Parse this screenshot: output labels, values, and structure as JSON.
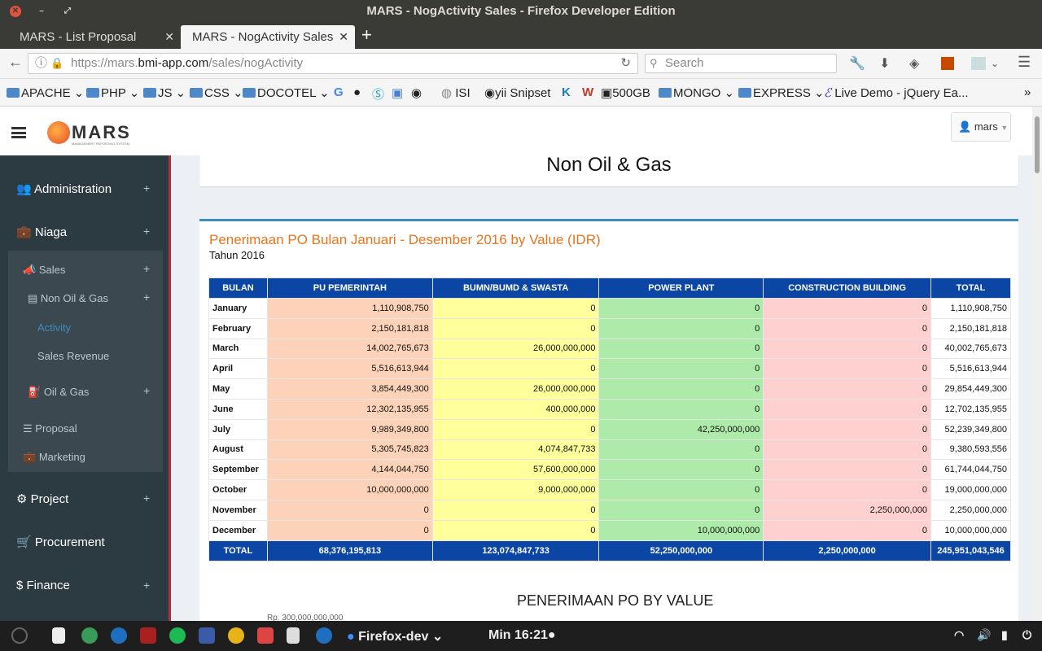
{
  "window": {
    "title": "MARS - NogActivity Sales - Firefox Developer Edition"
  },
  "tabs": [
    {
      "label": "MARS - List Proposal"
    },
    {
      "label": "MARS - NogActivity Sales"
    }
  ],
  "nav": {
    "url_prefix": "https://mars.",
    "url_domain": "bmi-app.com",
    "url_path": "/sales/nogActivity",
    "search_placeholder": "Search"
  },
  "bookmarks": [
    "APACHE",
    "PHP",
    "JS",
    "CSS",
    "DOCOTEL",
    "ISI",
    "yii Snipset",
    "500GB",
    "MONGO",
    "EXPRESS",
    "Live Demo - jQuery Ea..."
  ],
  "app": {
    "logo": "MARS",
    "logo_sub": "MANAGEMENT REPORTING SYSTEM",
    "user": "mars"
  },
  "sidebar": {
    "administration": "Administration",
    "niaga": "Niaga",
    "sales": "Sales",
    "non_oil_gas": "Non Oil & Gas",
    "activity": "Activity",
    "sales_revenue": "Sales Revenue",
    "oil_gas": "Oil & Gas",
    "proposal": "Proposal",
    "marketing": "Marketing",
    "project": "Project",
    "procurement": "Procurement",
    "finance": "Finance",
    "plus": "+"
  },
  "content": {
    "page_heading": "Non Oil & Gas",
    "box_title": "Penerimaan PO Bulan Januari - Desember 2016 by Value (IDR)",
    "box_subtitle": "Tahun 2016",
    "chart_title": "PENERIMAAN PO BY VALUE",
    "chart_axis_top": "Rp. 300,000,000,000"
  },
  "table": {
    "headers": [
      "BULAN",
      "PU PEMERINTAH",
      "BUMN/BUMD & SWASTA",
      "POWER PLANT",
      "CONSTRUCTION BUILDING",
      "TOTAL"
    ],
    "rows": [
      [
        "January",
        "1,110,908,750",
        "0",
        "0",
        "0",
        "1,110,908,750"
      ],
      [
        "February",
        "2,150,181,818",
        "0",
        "0",
        "0",
        "2,150,181,818"
      ],
      [
        "March",
        "14,002,765,673",
        "26,000,000,000",
        "0",
        "0",
        "40,002,765,673"
      ],
      [
        "April",
        "5,516,613,944",
        "0",
        "0",
        "0",
        "5,516,613,944"
      ],
      [
        "May",
        "3,854,449,300",
        "26,000,000,000",
        "0",
        "0",
        "29,854,449,300"
      ],
      [
        "June",
        "12,302,135,955",
        "400,000,000",
        "0",
        "0",
        "12,702,135,955"
      ],
      [
        "July",
        "9,989,349,800",
        "0",
        "42,250,000,000",
        "0",
        "52,239,349,800"
      ],
      [
        "August",
        "5,305,745,823",
        "4,074,847,733",
        "0",
        "0",
        "9,380,593,556"
      ],
      [
        "September",
        "4,144,044,750",
        "57,600,000,000",
        "0",
        "0",
        "61,744,044,750"
      ],
      [
        "October",
        "10,000,000,000",
        "9,000,000,000",
        "0",
        "0",
        "19,000,000,000"
      ],
      [
        "November",
        "0",
        "0",
        "0",
        "2,250,000,000",
        "2,250,000,000"
      ],
      [
        "December",
        "0",
        "0",
        "10,000,000,000",
        "0",
        "10,000,000,000"
      ]
    ],
    "total": [
      "TOTAL",
      "68,376,195,813",
      "123,074,847,733",
      "52,250,000,000",
      "2,250,000,000",
      "245,951,043,546"
    ]
  },
  "taskbar": {
    "app": "Firefox-dev",
    "clock": "Min 16:21"
  }
}
